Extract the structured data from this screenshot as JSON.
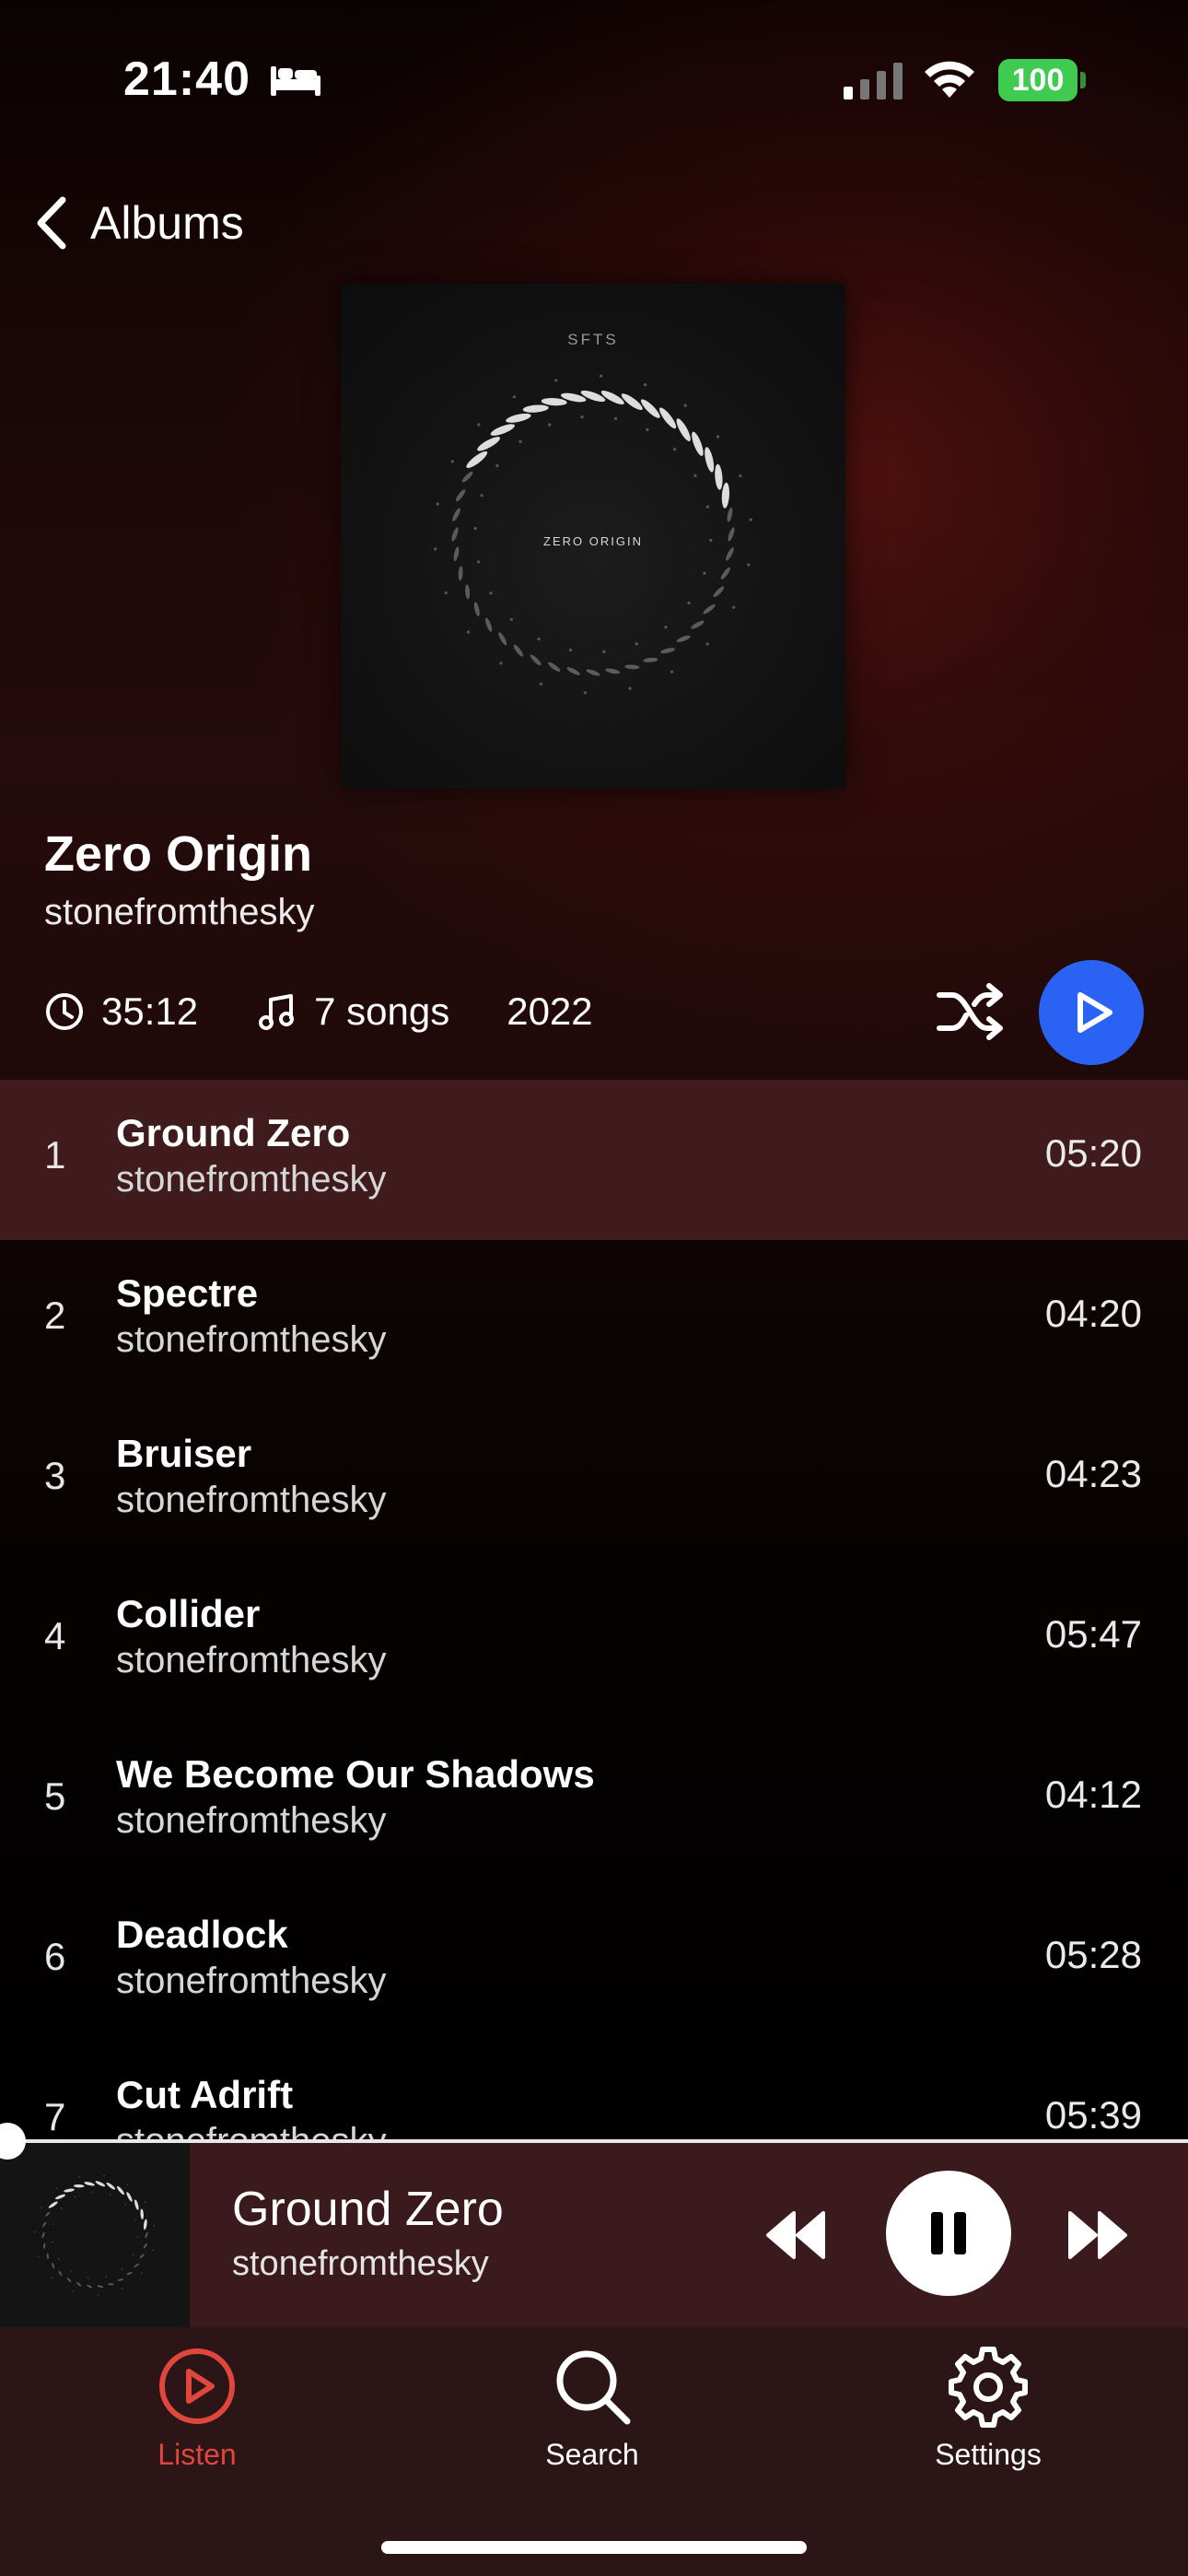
{
  "status_bar": {
    "time": "21:40",
    "battery": "100",
    "focus_icon": "bed-icon",
    "battery_color": "#3ecb4f"
  },
  "nav": {
    "back_label": "Albums"
  },
  "album": {
    "title": "Zero Origin",
    "artist": "stonefromthesky",
    "duration": "35:12",
    "song_count": "7 songs",
    "year": "2022",
    "art_brand": "SFTS",
    "art_title": "ZERO ORIGIN"
  },
  "tracks": [
    {
      "num": "1",
      "title": "Ground Zero",
      "artist": "stonefromthesky",
      "duration": "05:20",
      "active": true
    },
    {
      "num": "2",
      "title": "Spectre",
      "artist": "stonefromthesky",
      "duration": "04:20"
    },
    {
      "num": "3",
      "title": "Bruiser",
      "artist": "stonefromthesky",
      "duration": "04:23"
    },
    {
      "num": "4",
      "title": "Collider",
      "artist": "stonefromthesky",
      "duration": "05:47"
    },
    {
      "num": "5",
      "title": "We Become Our Shadows",
      "artist": "stonefromthesky",
      "duration": "04:12"
    },
    {
      "num": "6",
      "title": "Deadlock",
      "artist": "stonefromthesky",
      "duration": "05:28"
    },
    {
      "num": "7",
      "title": "Cut Adrift",
      "artist": "stonefromthesky",
      "duration": "05:39"
    }
  ],
  "now_playing": {
    "title": "Ground Zero",
    "artist": "stonefromthesky",
    "progress": 0
  },
  "tabs": [
    {
      "label": "Listen",
      "icon": "play-circle-icon",
      "active": true
    },
    {
      "label": "Search",
      "icon": "search-icon"
    },
    {
      "label": "Settings",
      "icon": "gear-icon"
    }
  ],
  "colors": {
    "accent": "#e0463b",
    "play_button": "#2a63f3",
    "active_row": "#482022",
    "mini_player": "#3a1a1d",
    "tab_bar": "#2c1517"
  }
}
